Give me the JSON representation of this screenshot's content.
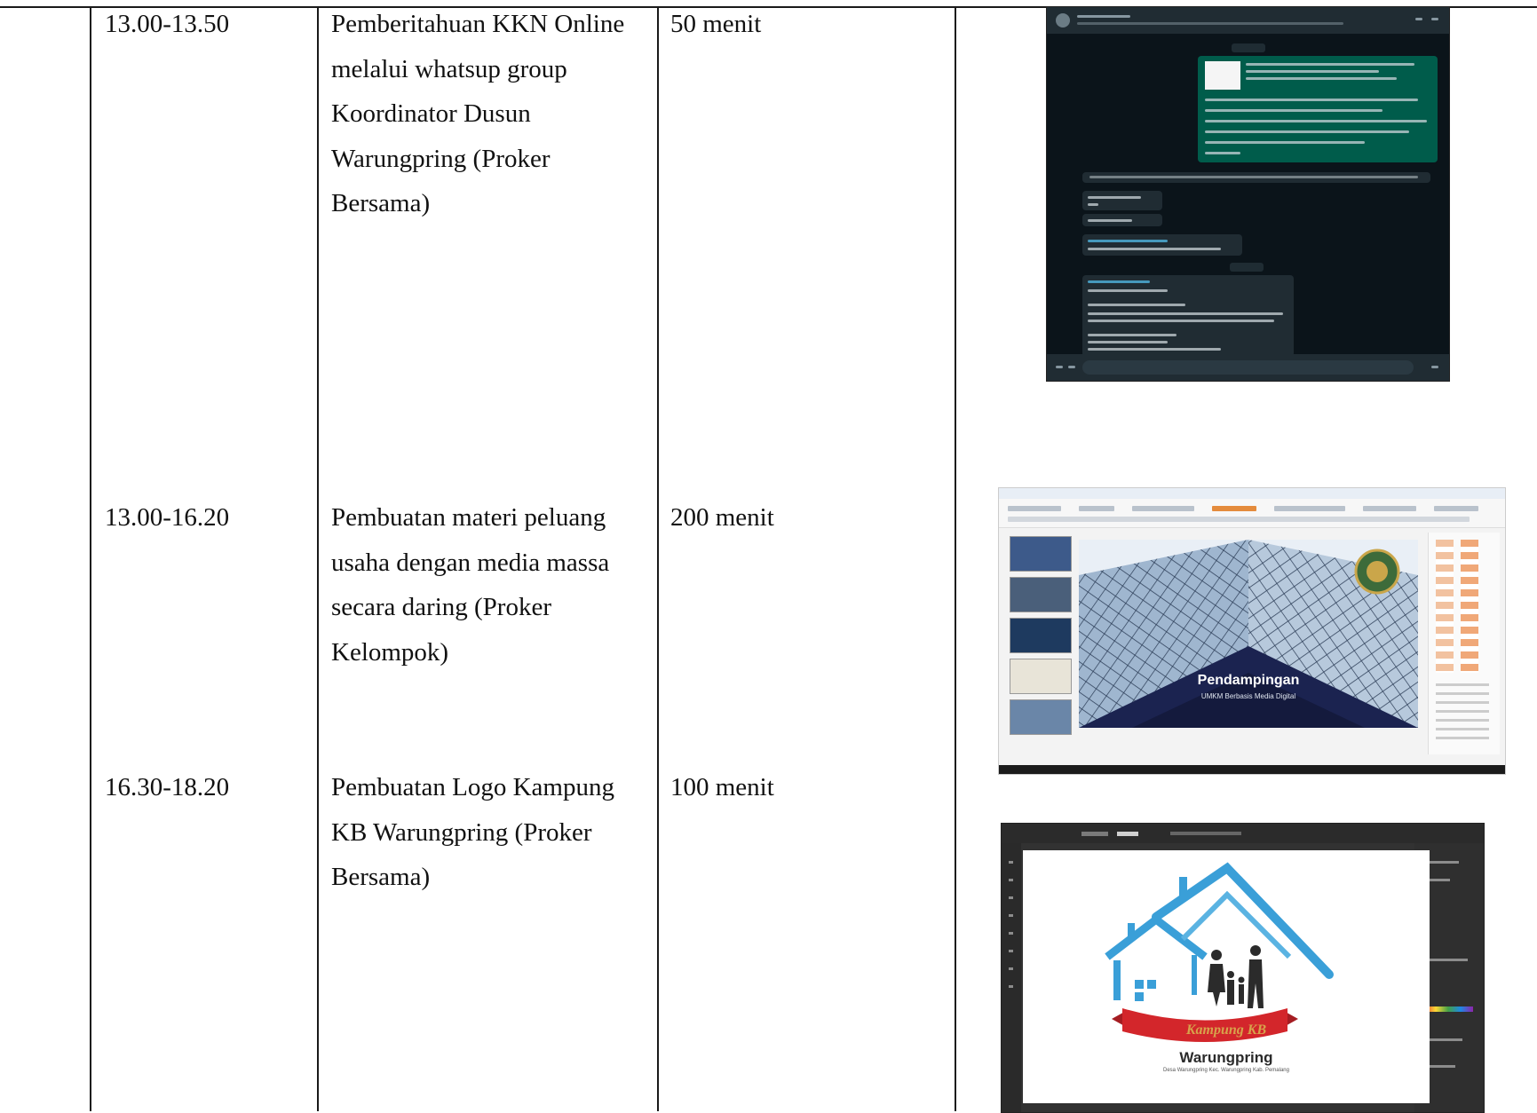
{
  "table": {
    "rows": [
      {
        "time": "13.00-13.50",
        "description": "Pemberitahuan KKN Online melalui whatsup group Koordinator Dusun Warungpring (Proker Bersama)",
        "duration": "50 menit"
      },
      {
        "time": "13.00-16.20",
        "description": "Pembuatan materi peluang usaha dengan media massa secara daring (Proker Kelompok)",
        "duration": "200 menit"
      },
      {
        "time": "16.30-18.20",
        "description": "Pembuatan Logo Kampung KB Warungpring (Proker Bersama)",
        "duration": "100 menit"
      }
    ]
  },
  "screenshots": {
    "ppt": {
      "slide_title": "Pendampingan",
      "slide_subtitle": "UMKM Berbasis Media Digital"
    },
    "logo": {
      "banner_text": "Kampung KB",
      "word": "Warungpring",
      "subtitle": "Desa Warungpring Kec. Warungpring Kab. Pemalang"
    }
  },
  "colors": {
    "whatsapp_bg": "#0b141a",
    "whatsapp_outgoing": "#005c4b",
    "logo_blue": "#3a9fd8",
    "logo_red": "#d3262b"
  }
}
